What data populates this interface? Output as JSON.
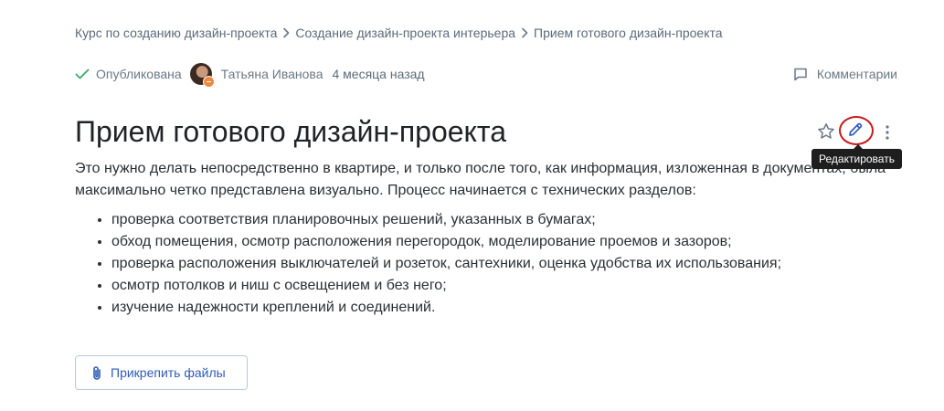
{
  "breadcrumb": {
    "items": [
      "Курс по созданию дизайн-проекта",
      "Создание дизайн-проекта интерьера",
      "Прием готового дизайн-проекта"
    ]
  },
  "meta": {
    "status": "Опубликована",
    "author": "Татьяна Иванова",
    "time": "4 месяца назад",
    "comments_label": "Комментарии"
  },
  "article": {
    "title": "Прием готового дизайн-проекта",
    "intro": "Это нужно делать непосредственно в квартире, и только после того, как информация, изложенная в документах, была максимально четко представлена визуально. Процесс начинается с технических разделов:",
    "list": [
      "проверка соответствия планировочных решений, указанных в бумагах;",
      "обход помещения, осмотр расположения перегородок, моделирование проемов и зазоров;",
      "проверка расположения выключателей и розеток, сантехники, оценка удобства их использования;",
      "осмотр потолков и ниш с освещением и без него;",
      "изучение надежности креплений и соединений."
    ]
  },
  "toolbar": {
    "edit_tooltip": "Редактировать"
  },
  "attach_label": "Прикрепить файлы",
  "icons": {
    "status": "check-icon",
    "comments": "comment-icon",
    "favorite": "star-icon",
    "edit": "pencil-icon",
    "more": "more-vertical-icon",
    "attach": "paperclip-icon"
  },
  "colors": {
    "accent": "#2f5bb8",
    "status_check": "#3aa86b",
    "highlight_ring": "#c61a1a",
    "tooltip_bg": "#1e1e1e"
  }
}
